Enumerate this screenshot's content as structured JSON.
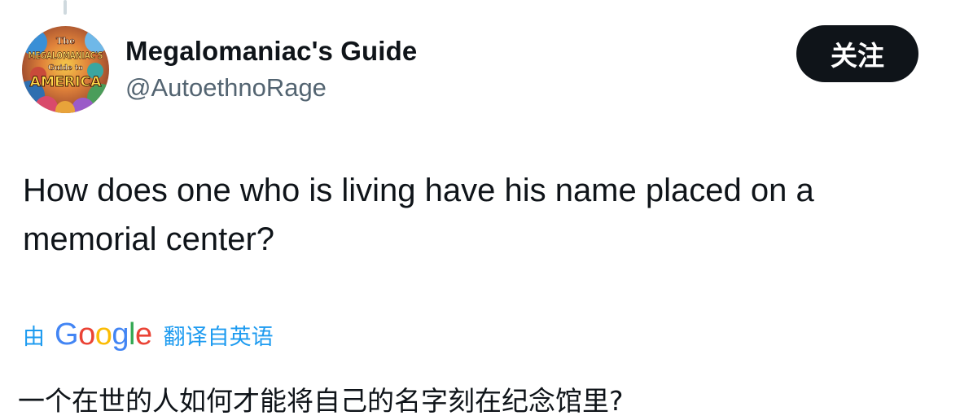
{
  "author": {
    "name": "Megalomaniac's Guide",
    "handle": "@AutoethnoRage",
    "avatar_text": [
      "The",
      "MEGALOMANIAC'S",
      "Guide to",
      "AMERICA"
    ]
  },
  "follow_button": {
    "label": "关注"
  },
  "tweet": {
    "text": "How does one who is living have his name placed on a memorial center?"
  },
  "translation": {
    "prefix": "由",
    "provider": "Google",
    "link_label": "翻译自英语",
    "text": "一个在世的人如何才能将自己的名字刻在纪念馆里?"
  },
  "colors": {
    "accent": "#1d9bf0",
    "text_primary": "#0f1419",
    "text_secondary": "#536471",
    "button_bg": "#0f1419"
  }
}
